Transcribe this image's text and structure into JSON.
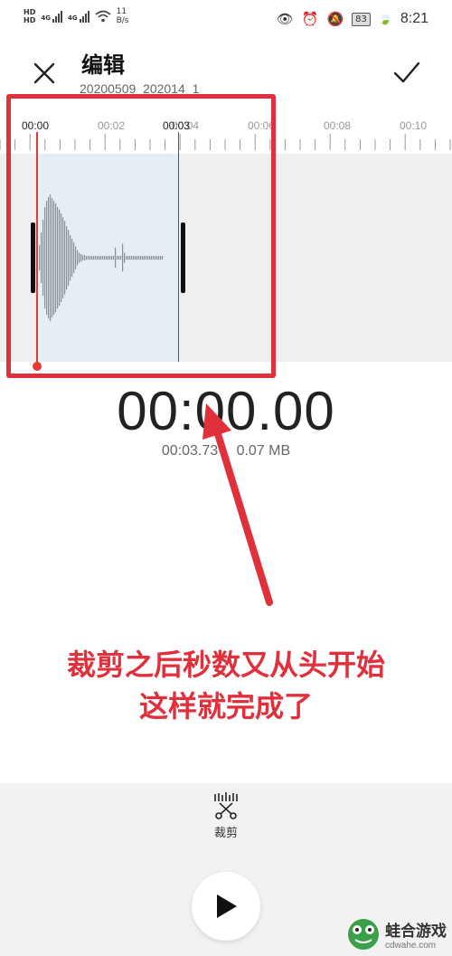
{
  "status_bar": {
    "network_speed_value": "11",
    "network_speed_unit": "B/s",
    "battery": "83",
    "time": "8:21",
    "hd1": "HD",
    "hd2": "HD",
    "net1": "4G",
    "net2": "4G"
  },
  "header": {
    "title": "编辑",
    "subtitle": "20200509_202014_1",
    "close_icon": "close-icon",
    "confirm_icon": "check-icon"
  },
  "ruler": {
    "labels": [
      "00:00",
      "00:02",
      "00:04",
      "00:06",
      "00:08",
      "00:10"
    ],
    "selection_end_label": "00:03"
  },
  "player": {
    "current_time": "00:00.00",
    "duration": "00:03.73",
    "file_size": "0.07 MB"
  },
  "annotation": {
    "line1": "裁剪之后秒数又从头开始",
    "line2": "这样就完成了",
    "color": "#e0303c"
  },
  "toolbar": {
    "trim_label": "裁剪",
    "trim_icon": "scissors-icon",
    "play_icon": "play-icon"
  },
  "watermark": {
    "title": "蛙合游戏",
    "url": "cdwahe.com"
  },
  "colors": {
    "accent_red": "#e53935",
    "selection": "#e4eef4",
    "wave_bg": "#efefef"
  }
}
